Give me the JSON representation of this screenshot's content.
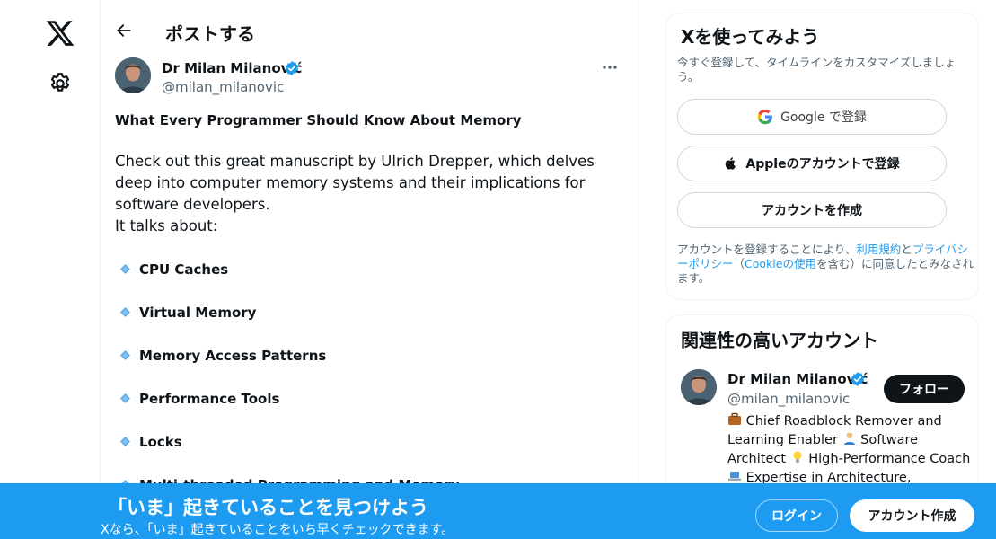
{
  "colors": {
    "accent": "#1d9bf0",
    "text": "#0f1419",
    "muted": "#536471",
    "border": "#eff3f4"
  },
  "nav": {
    "logo_icon": "x-logo-icon",
    "settings_icon": "gear-icon"
  },
  "header": {
    "back_icon": "back-arrow-icon",
    "title": "ポストする"
  },
  "post": {
    "author_name": "Dr Milan Milanović",
    "author_handle": "@milan_milanovic",
    "title": "What Every Programmer Should Know About Memory",
    "body": "Check out this great manuscript by Ulrich Drepper, which delves deep into computer memory systems and their implications for software developers.",
    "talks": "It talks about:",
    "bullets": [
      "CPU Caches",
      "Virtual Memory",
      "Memory Access Patterns",
      "Performance Tools",
      "Locks",
      "Multi-threaded Programming and Memory"
    ]
  },
  "signup_card": {
    "title": "Xを使ってみよう",
    "description": "今すぐ登録して、タイムラインをカスタマイズしましょう。",
    "google_label": "Google で登録",
    "apple_label": "Appleのアカウントで登録",
    "create_label": "アカウントを作成",
    "terms_prefix": "アカウントを登録することにより、",
    "terms_link": "利用規約",
    "terms_and": "と",
    "privacy_link": "プライバシーポリシー",
    "terms_paren_open": "（",
    "cookie_link": "Cookieの使用",
    "terms_suffix": "を含む）に同意したとみなされます。"
  },
  "related": {
    "title": "関連性の高いアカウント",
    "name": "Dr Milan Milanović",
    "handle": "@milan_milanovic",
    "follow_label": "フォロー",
    "bio_1": "Chief Roadblock Remover and Learning Enabler",
    "bio_2": "Software Architect",
    "bio_3": "High-Performance Coach",
    "bio_4": "Expertise in Architecture,"
  },
  "banner": {
    "title": "「いま」起きていることを見つけよう",
    "subtitle": "Xなら、「いま」起きていることをいち早くチェックできます。",
    "login_label": "ログイン",
    "signup_label": "アカウント作成"
  }
}
